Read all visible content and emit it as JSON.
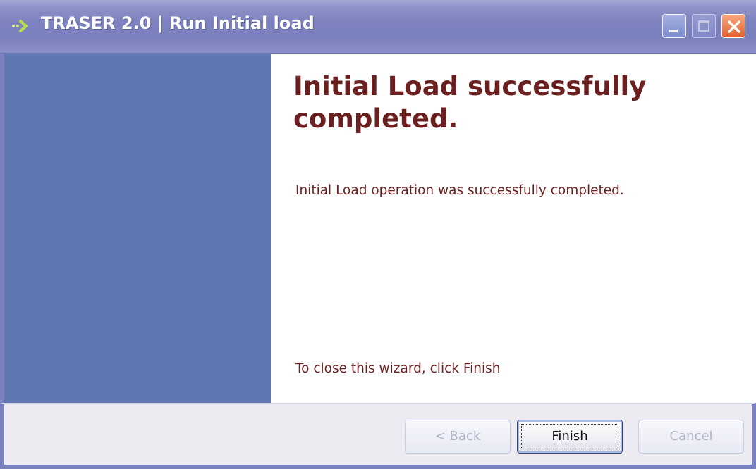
{
  "window": {
    "title": "TRASER 2.0 | Run Initial load",
    "icon": "arrow-right-icon",
    "controls": {
      "minimize": "minimize-icon",
      "maximize": "maximize-icon",
      "close": "close-icon"
    }
  },
  "content": {
    "heading": "Initial Load successfully completed.",
    "message": "Initial Load operation was successfully completed.",
    "instruction": "To close this wizard, click Finish"
  },
  "buttons": {
    "back": {
      "label": "< Back",
      "enabled": false
    },
    "finish": {
      "label": "Finish",
      "enabled": true
    },
    "cancel": {
      "label": "Cancel",
      "enabled": false
    }
  },
  "colors": {
    "title_bar": "#7b80be",
    "side_panel": "#6078b2",
    "text_accent": "#6b1f1f",
    "button_bar": "#ebebf1"
  }
}
